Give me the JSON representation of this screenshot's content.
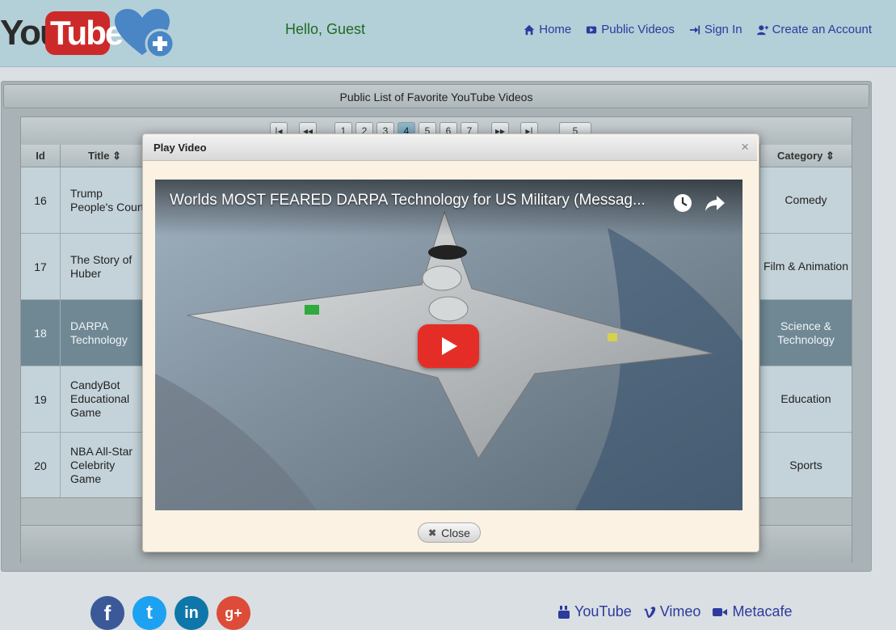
{
  "header": {
    "logo_you": "You",
    "logo_tube": "Tube",
    "greeting": "Hello, Guest",
    "nav": [
      {
        "label": "Home",
        "icon": "home-icon"
      },
      {
        "label": "Public Videos",
        "icon": "video-icon"
      },
      {
        "label": "Sign In",
        "icon": "sign-in-icon"
      },
      {
        "label": "Create an Account",
        "icon": "add-user-icon"
      }
    ]
  },
  "grid": {
    "title": "Public List of Favorite YouTube Videos",
    "pager": {
      "pages": [
        "1",
        "2",
        "3",
        "4",
        "5",
        "6",
        "7"
      ],
      "current_page": "4",
      "rows_per_page": "5"
    },
    "columns": {
      "id": "Id",
      "title": "Title",
      "category": "Category"
    },
    "rows": [
      {
        "id": "16",
        "title": "Trump People's Court",
        "category": "Comedy"
      },
      {
        "id": "17",
        "title": "The Story of Huber",
        "category": "Film & Animation"
      },
      {
        "id": "18",
        "title": "DARPA Technology",
        "category": "Science & Technology",
        "selected": true
      },
      {
        "id": "19",
        "title": "CandyBot Educational Game",
        "category": "Education"
      },
      {
        "id": "20",
        "title": "NBA All-Star Celebrity Game",
        "category": "Sports"
      }
    ]
  },
  "modal": {
    "title": "Play Video",
    "close_symbol": "×",
    "video_title": "Worlds MOST FEARED DARPA Technology for US Military (Messag...",
    "close_label": "Close"
  },
  "footer": {
    "social": [
      {
        "icon": "facebook-icon",
        "glyph": "f",
        "color": "#3b5998"
      },
      {
        "icon": "twitter-icon",
        "glyph": "t",
        "color": "#1da1f2"
      },
      {
        "icon": "linkedin-icon",
        "glyph": "in",
        "color": "#0e76a8"
      },
      {
        "icon": "google-plus-icon",
        "glyph": "g+",
        "color": "#dd4b39"
      }
    ],
    "links": [
      {
        "label": "YouTube",
        "icon": "youtube-icon"
      },
      {
        "label": "Vimeo",
        "icon": "vimeo-icon"
      },
      {
        "label": "Metacafe",
        "icon": "metacafe-icon"
      }
    ]
  },
  "colors": {
    "header_bg": "#b3cfd8",
    "link": "#2d3a9e",
    "greeting": "#1f6b1f",
    "selected_row": "#6f8894",
    "play_button": "#e52d27"
  }
}
